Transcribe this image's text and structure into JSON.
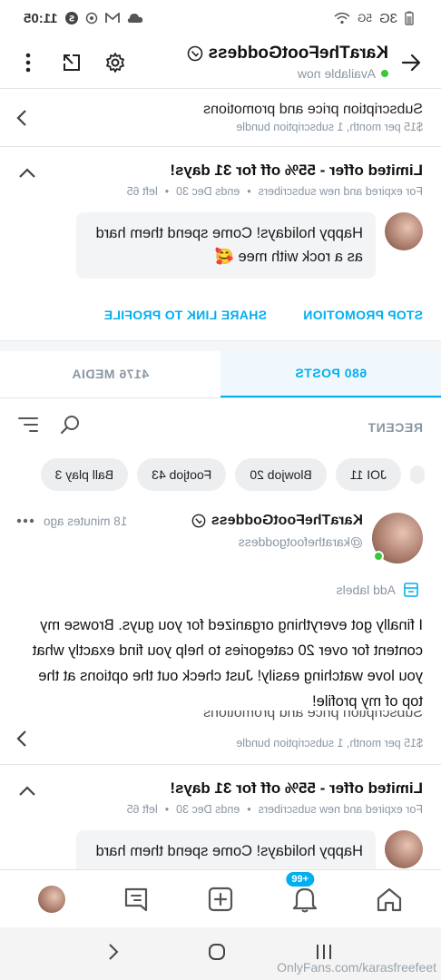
{
  "statusbar": {
    "time": "11:05",
    "network": "5G",
    "signal": "3G",
    "icons": [
      "cloud-icon",
      "gmail-icon",
      "sync-icon",
      "s-badge-icon",
      "battery-icon",
      "wifi-icon"
    ]
  },
  "header": {
    "name": "KaraTheFootGoddess",
    "status": "Available now",
    "online_color": "#3ac73a"
  },
  "subscription": {
    "title": "Subscription price and promotions",
    "details": "$15 per month, 1 subscription bundle"
  },
  "promotion": {
    "title": "Limited offer - 55% off for 31 days!",
    "audience": "For expired and new subscribers",
    "ends": "ends Dec 30",
    "left": "left 65",
    "message": "Happy holidays! Come spend them hard as a rock with mee 🥰",
    "stop_label": "STOP PROMOTION",
    "share_label": "SHARE LINK TO PROFILE"
  },
  "tabs": {
    "posts": "680 POSTS",
    "media": "4176 MEDIA"
  },
  "filter": {
    "label": "RECENT"
  },
  "chips": [
    "JOI 11",
    "Blowjob 20",
    "Footjob 43",
    "Ball play 3"
  ],
  "post": {
    "name": "KaraTheFootGoddess",
    "handle": "@karathefootgoddess",
    "time": "18 minutes ago",
    "add_labels": "Add labels",
    "text": "I finally got everything organized for you guys. Browse my content for over 20 categories to help you find exactly what you love watching easily! Just check out the options at the top of my profile!"
  },
  "subscription2": {
    "title": "Subscription price and promotions",
    "details": "$15 per month, 1 subscription bundle"
  },
  "promotion2": {
    "title": "Limited offer - 55% off for 31 days!",
    "audience": "For expired and new subscribers",
    "ends": "ends Dec 30",
    "left": "left 65",
    "message": "Happy holidays! Come spend them hard as a"
  },
  "bottomnav": {
    "notifications_badge": "99+"
  },
  "watermark": "OnlyFans.com/karasfreefeet",
  "colors": {
    "accent": "#00aff0",
    "muted": "#8a96a3"
  }
}
